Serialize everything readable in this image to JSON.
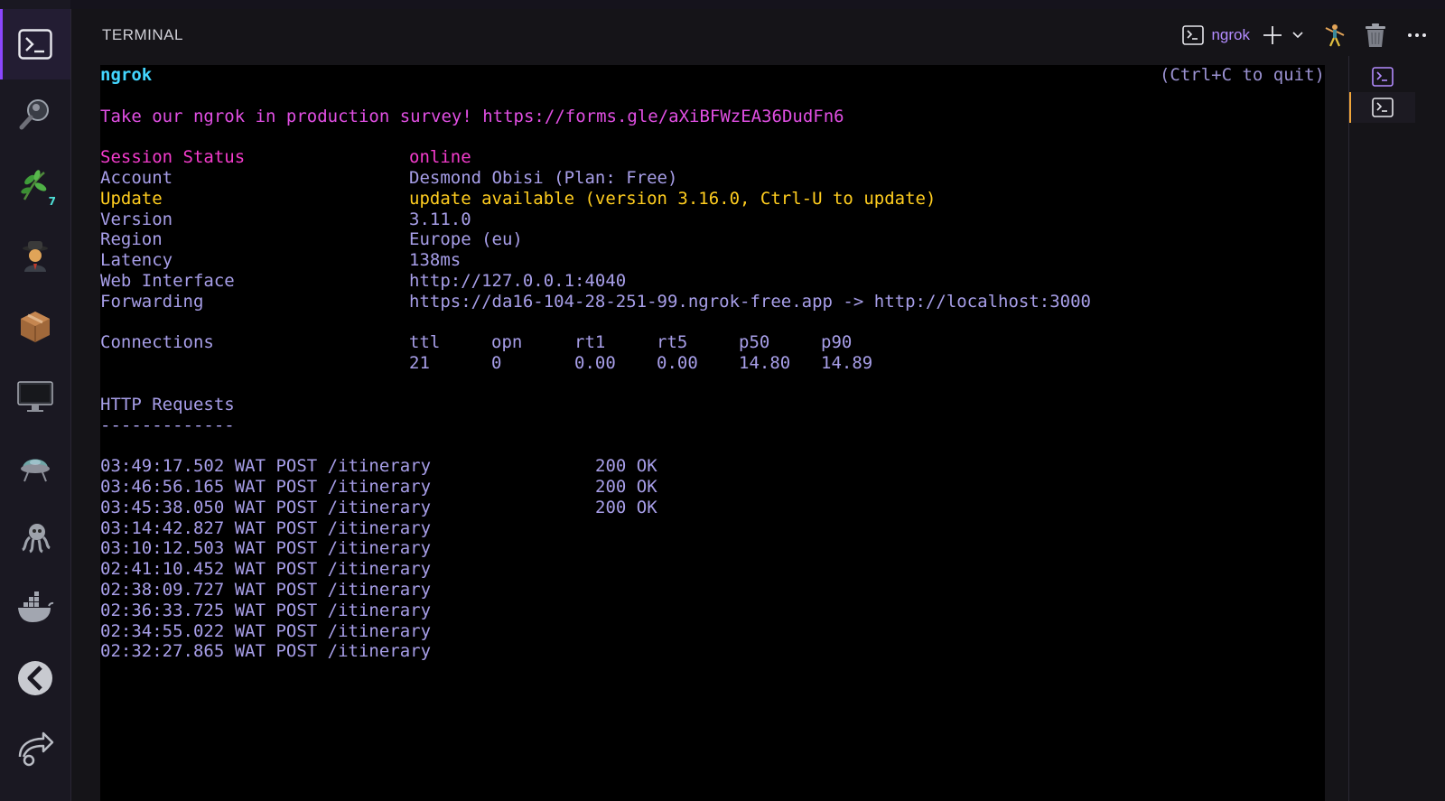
{
  "activity_bar": {
    "items": [
      {
        "icon": "terminal-icon",
        "active": true
      },
      {
        "icon": "search-icon"
      },
      {
        "icon": "git-branch-icon",
        "badge": "7"
      },
      {
        "icon": "spy-icon"
      },
      {
        "icon": "package-icon"
      },
      {
        "icon": "monitor-icon"
      },
      {
        "icon": "remote-explorer-icon"
      },
      {
        "icon": "octopus-icon"
      },
      {
        "icon": "docker-icon"
      },
      {
        "icon": "kubernetes-icon"
      },
      {
        "icon": "live-share-icon"
      }
    ]
  },
  "panel": {
    "title": "TERMINAL",
    "active_terminal_label": "ngrok",
    "actions": [
      "new-terminal-icon",
      "chevron-down-icon",
      "split-terminal-icon",
      "trash-icon",
      "more-icon"
    ]
  },
  "terminal": {
    "app_name": "ngrok",
    "quit_hint": "(Ctrl+C to quit)",
    "survey": "Take our ngrok in production survey! https://forms.gle/aXiBFWzEA36DudFn6",
    "session": {
      "status_label": "Session Status",
      "status_value": "online",
      "account_label": "Account",
      "account_value": "Desmond Obisi (Plan: Free)",
      "update_label": "Update",
      "update_value": "update available (version 3.16.0, Ctrl-U to update)",
      "version_label": "Version",
      "version_value": "3.11.0",
      "region_label": "Region",
      "region_value": "Europe (eu)",
      "latency_label": "Latency",
      "latency_value": "138ms",
      "web_label": "Web Interface",
      "web_value": "http://127.0.0.1:4040",
      "forwarding_label": "Forwarding",
      "forwarding_value": "https://da16-104-28-251-99.ngrok-free.app -> http://localhost:3000"
    },
    "connections": {
      "label": "Connections",
      "headers": [
        "ttl",
        "opn",
        "rt1",
        "rt5",
        "p50",
        "p90"
      ],
      "values": [
        "21",
        "0",
        "0.00",
        "0.00",
        "14.80",
        "14.89"
      ]
    },
    "http": {
      "label": "HTTP Requests",
      "divider": "-------------",
      "requests": [
        {
          "line": "03:49:17.502 WAT POST /itinerary",
          "status": "200 OK"
        },
        {
          "line": "03:46:56.165 WAT POST /itinerary",
          "status": "200 OK"
        },
        {
          "line": "03:45:38.050 WAT POST /itinerary",
          "status": "200 OK"
        },
        {
          "line": "03:14:42.827 WAT POST /itinerary",
          "status": ""
        },
        {
          "line": "03:10:12.503 WAT POST /itinerary",
          "status": ""
        },
        {
          "line": "02:41:10.452 WAT POST /itinerary",
          "status": ""
        },
        {
          "line": "02:38:09.727 WAT POST /itinerary",
          "status": ""
        },
        {
          "line": "02:36:33.725 WAT POST /itinerary",
          "status": ""
        },
        {
          "line": "02:34:55.022 WAT POST /itinerary",
          "status": ""
        },
        {
          "line": "02:32:27.865 WAT POST /itinerary",
          "status": ""
        }
      ]
    }
  },
  "right_bar": {
    "items": [
      {
        "icon": "terminal-icon"
      },
      {
        "icon": "terminal-icon",
        "active": true
      }
    ]
  },
  "colors": {
    "accent_purple": "#8b46ff",
    "cyan": "#43d6ff",
    "magenta": "#e14fe3",
    "yellow": "#ffcd1f",
    "lavender": "#a79ee8"
  }
}
